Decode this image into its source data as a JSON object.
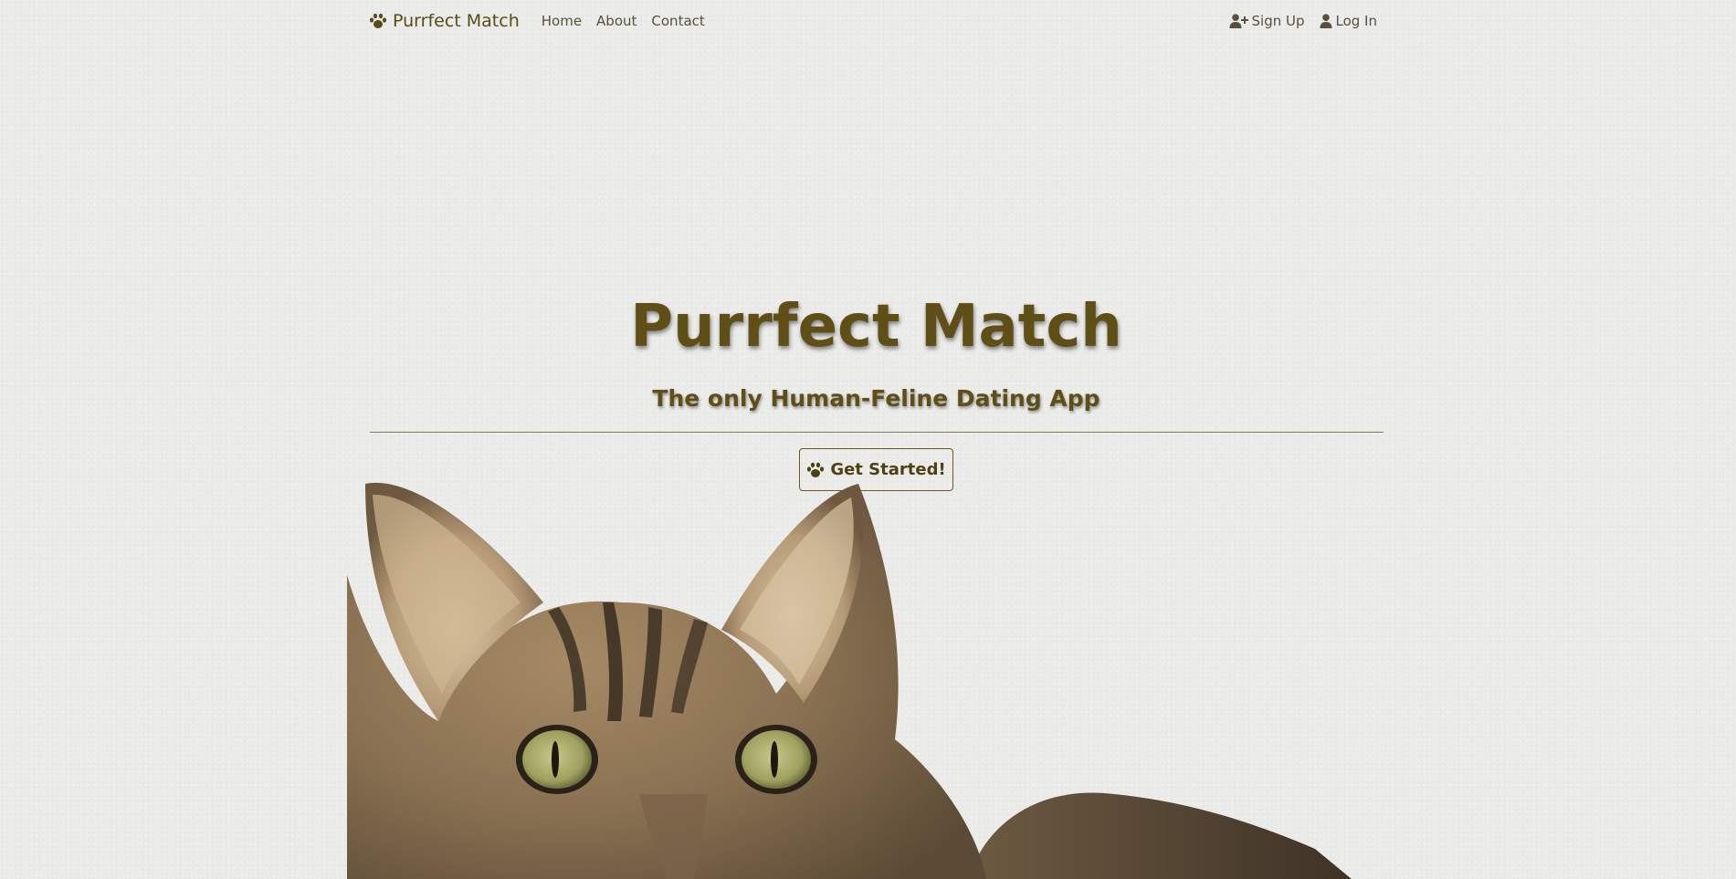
{
  "nav": {
    "brand": "Purrfect Match",
    "links": [
      "Home",
      "About",
      "Contact"
    ],
    "signup": "Sign Up",
    "login": "Log In"
  },
  "hero": {
    "title": "Purrfect Match",
    "subtitle": "The only Human-Feline Dating App",
    "cta": "Get Started!"
  },
  "colors": {
    "brand_text": "#5f4f16",
    "nav_text": "#55503f",
    "background": "#ebebea"
  },
  "icons": {
    "brand": "paw-icon",
    "signup": "user-plus-icon",
    "login": "user-icon",
    "cta": "paw-icon"
  }
}
